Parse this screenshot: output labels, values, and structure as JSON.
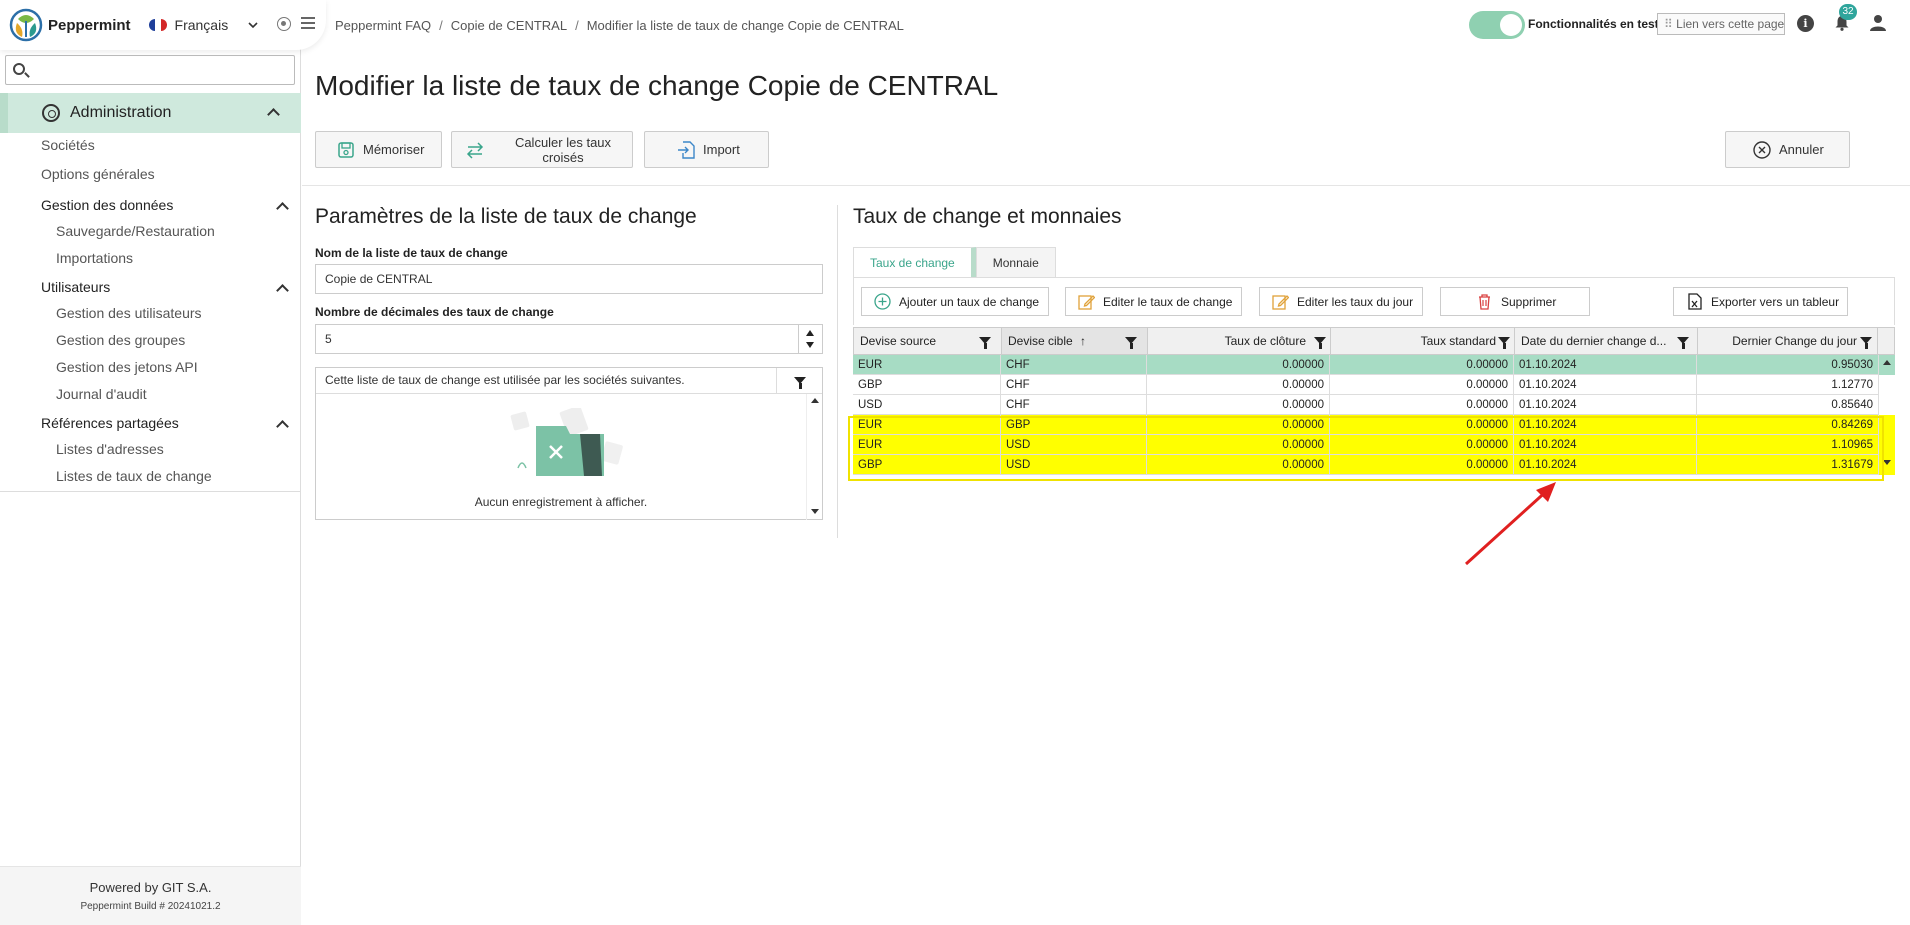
{
  "app": {
    "name": "Peppermint",
    "language": "Français",
    "powered_by": "Powered by GIT S.A.",
    "build": "Peppermint Build # 20241021.2"
  },
  "sidebar": {
    "search_placeholder": "",
    "section": "Administration",
    "items": [
      {
        "label": "Sociétés",
        "level": 1
      },
      {
        "label": "Options générales",
        "level": 1
      },
      {
        "label": "Gestion des données",
        "level": 1,
        "group": true
      },
      {
        "label": "Sauvegarde/Restauration",
        "level": 2
      },
      {
        "label": "Importations",
        "level": 2
      },
      {
        "label": "Utilisateurs",
        "level": 1,
        "group": true
      },
      {
        "label": "Gestion des utilisateurs",
        "level": 2
      },
      {
        "label": "Gestion des groupes",
        "level": 2
      },
      {
        "label": "Gestion des jetons API",
        "level": 2
      },
      {
        "label": "Journal d'audit",
        "level": 2
      },
      {
        "label": "Références partagées",
        "level": 1,
        "group": true
      },
      {
        "label": "Listes d'adresses",
        "level": 2
      },
      {
        "label": "Listes de taux de change",
        "level": 2
      }
    ]
  },
  "topbar": {
    "breadcrumb": [
      "Peppermint FAQ",
      "Copie de CENTRAL",
      "Modifier la liste de taux de change Copie de CENTRAL"
    ],
    "toggle_label": "Fonctionnalités en test",
    "link_label": "Lien vers cette page",
    "notifications": "32"
  },
  "page": {
    "title": "Modifier la liste de taux de change Copie de CENTRAL",
    "buttons": {
      "save": "Mémoriser",
      "cross": "Calculer les taux croisés",
      "import": "Import",
      "cancel": "Annuler"
    }
  },
  "params": {
    "title": "Paramètres de la liste de taux de change",
    "name_label": "Nom de la liste de taux de change",
    "name_value": "Copie de CENTRAL",
    "decimals_label": "Nombre de décimales des taux de change",
    "decimals_value": "5",
    "companies_header": "Cette liste de taux de change est utilisée par les sociétés suivantes.",
    "empty_text": "Aucun enregistrement à afficher."
  },
  "rates": {
    "title": "Taux de change et monnaies",
    "tabs": [
      "Taux de change",
      "Monnaie"
    ],
    "toolbar": {
      "add": "Ajouter un taux de change",
      "edit": "Editer le taux de change",
      "edit_day": "Editer les taux du jour",
      "delete": "Supprimer",
      "export": "Exporter vers un tableur"
    },
    "columns": [
      "Devise source",
      "Devise cible",
      "Taux de clôture",
      "Taux standard",
      "Date du dernier change d...",
      "Dernier Change du jour"
    ],
    "rows": [
      [
        "EUR",
        "CHF",
        "0.00000",
        "0.00000",
        "01.10.2024",
        "0.95030"
      ],
      [
        "GBP",
        "CHF",
        "0.00000",
        "0.00000",
        "01.10.2024",
        "1.12770"
      ],
      [
        "USD",
        "CHF",
        "0.00000",
        "0.00000",
        "01.10.2024",
        "0.85640"
      ],
      [
        "EUR",
        "GBP",
        "0.00000",
        "0.00000",
        "01.10.2024",
        "0.84269"
      ],
      [
        "EUR",
        "USD",
        "0.00000",
        "0.00000",
        "01.10.2024",
        "1.10965"
      ],
      [
        "GBP",
        "USD",
        "0.00000",
        "0.00000",
        "01.10.2024",
        "1.31679"
      ]
    ]
  },
  "colors": {
    "accent": "#3aa58b",
    "selected_row": "#a7dcc4",
    "highlight": "#ffff00",
    "annotation_arrow": "#e02020"
  }
}
